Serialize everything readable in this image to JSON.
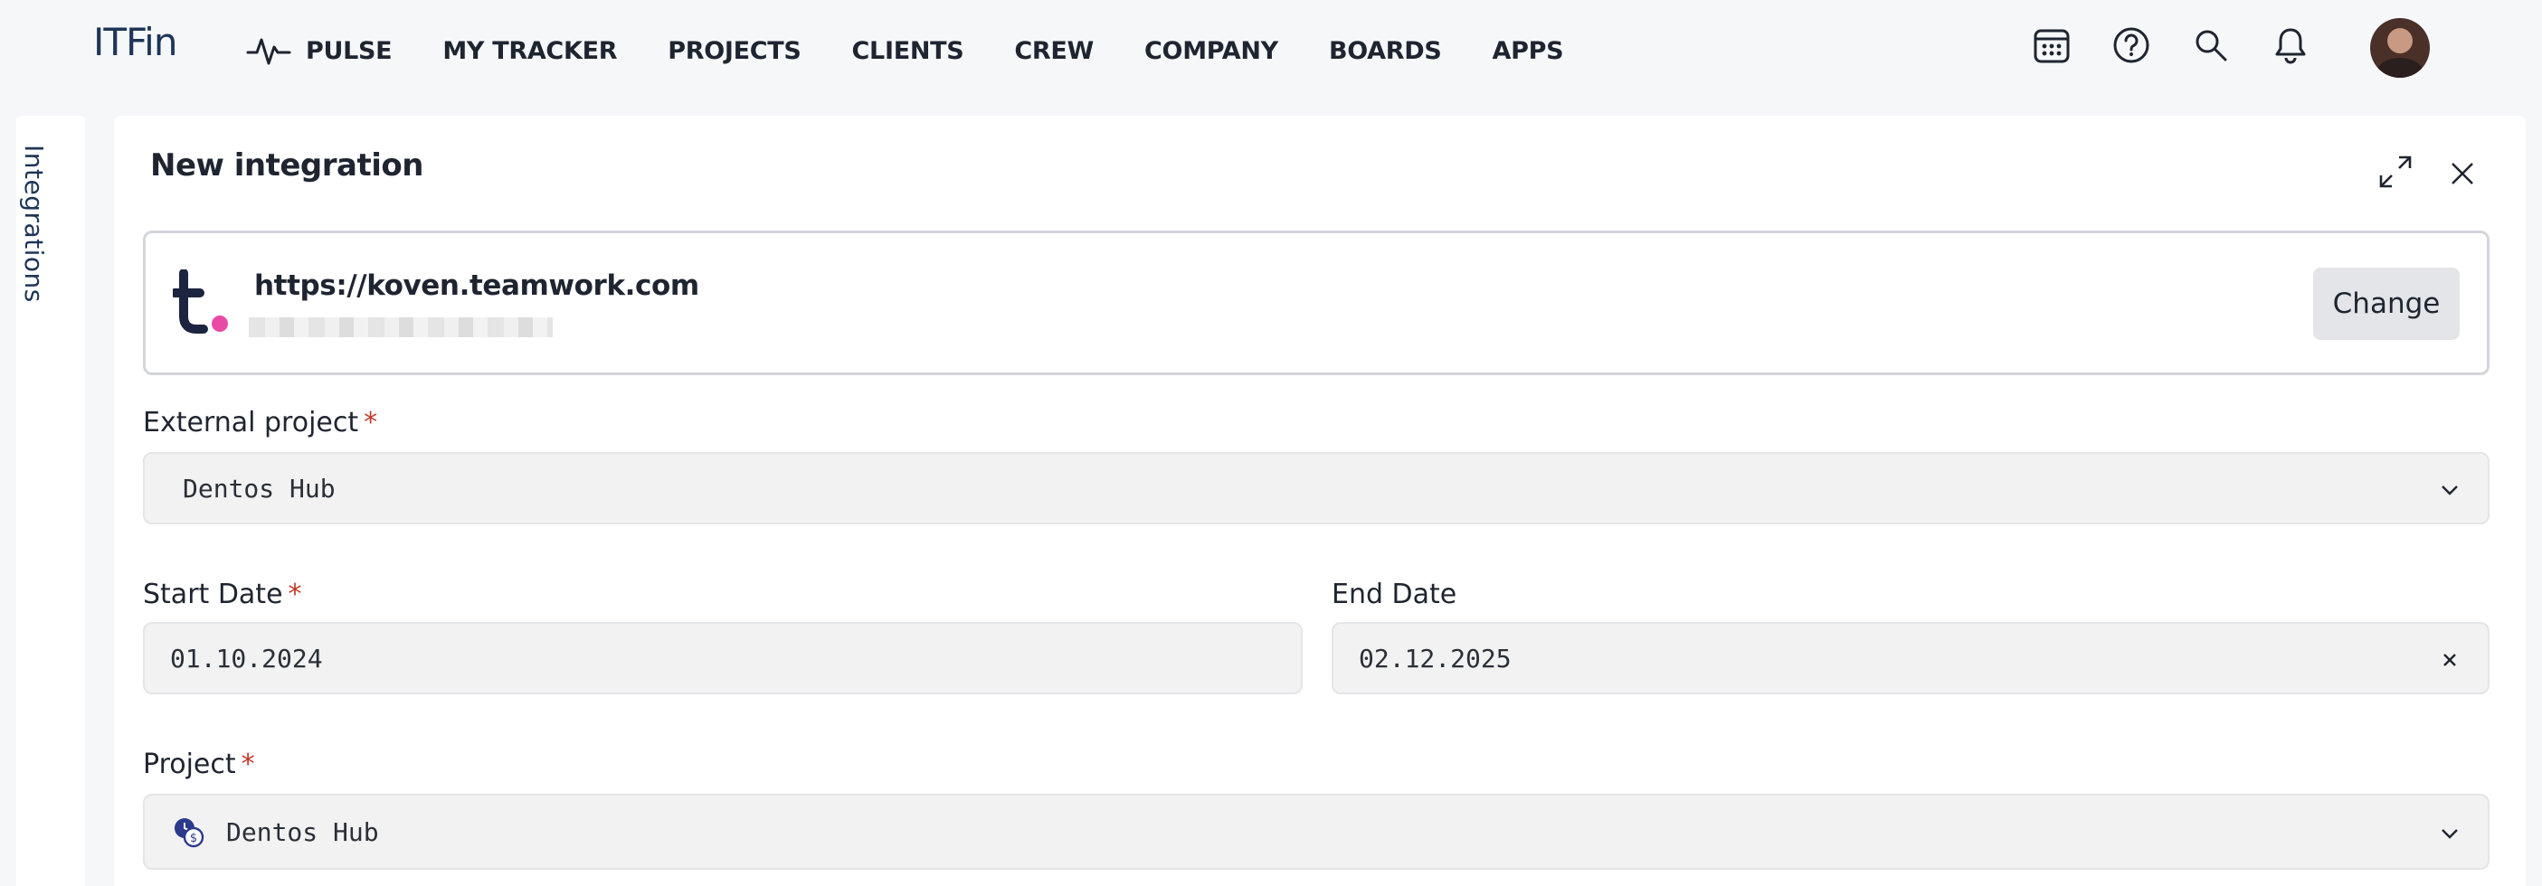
{
  "app": {
    "logo": "ITFin"
  },
  "nav": [
    {
      "label": "PULSE",
      "icon": "pulse-icon"
    },
    {
      "label": "MY TRACKER"
    },
    {
      "label": "PROJECTS"
    },
    {
      "label": "CLIENTS"
    },
    {
      "label": "CREW"
    },
    {
      "label": "COMPANY"
    },
    {
      "label": "BOARDS"
    },
    {
      "label": "APPS"
    }
  ],
  "top_icons": [
    "calendar-icon",
    "help-icon",
    "search-icon",
    "bell-icon"
  ],
  "siderail": {
    "label": "Integrations"
  },
  "panel": {
    "title": "New integration",
    "connection": {
      "url": "https://koven.teamwork.com",
      "change_label": "Change",
      "logo_color": "#e94aa6"
    },
    "external_project": {
      "label": "External project",
      "required": "*",
      "value": "Dentos Hub"
    },
    "start_date": {
      "label": "Start Date",
      "required": "*",
      "value": "01.10.2024"
    },
    "end_date": {
      "label": "End Date",
      "value": "02.12.2025"
    },
    "project": {
      "label": "Project",
      "required": "*",
      "value": "Dentos Hub"
    }
  },
  "colors": {
    "accent": "#1d3557",
    "required": "#c0392b",
    "brand_dot": "#e94aa6"
  }
}
